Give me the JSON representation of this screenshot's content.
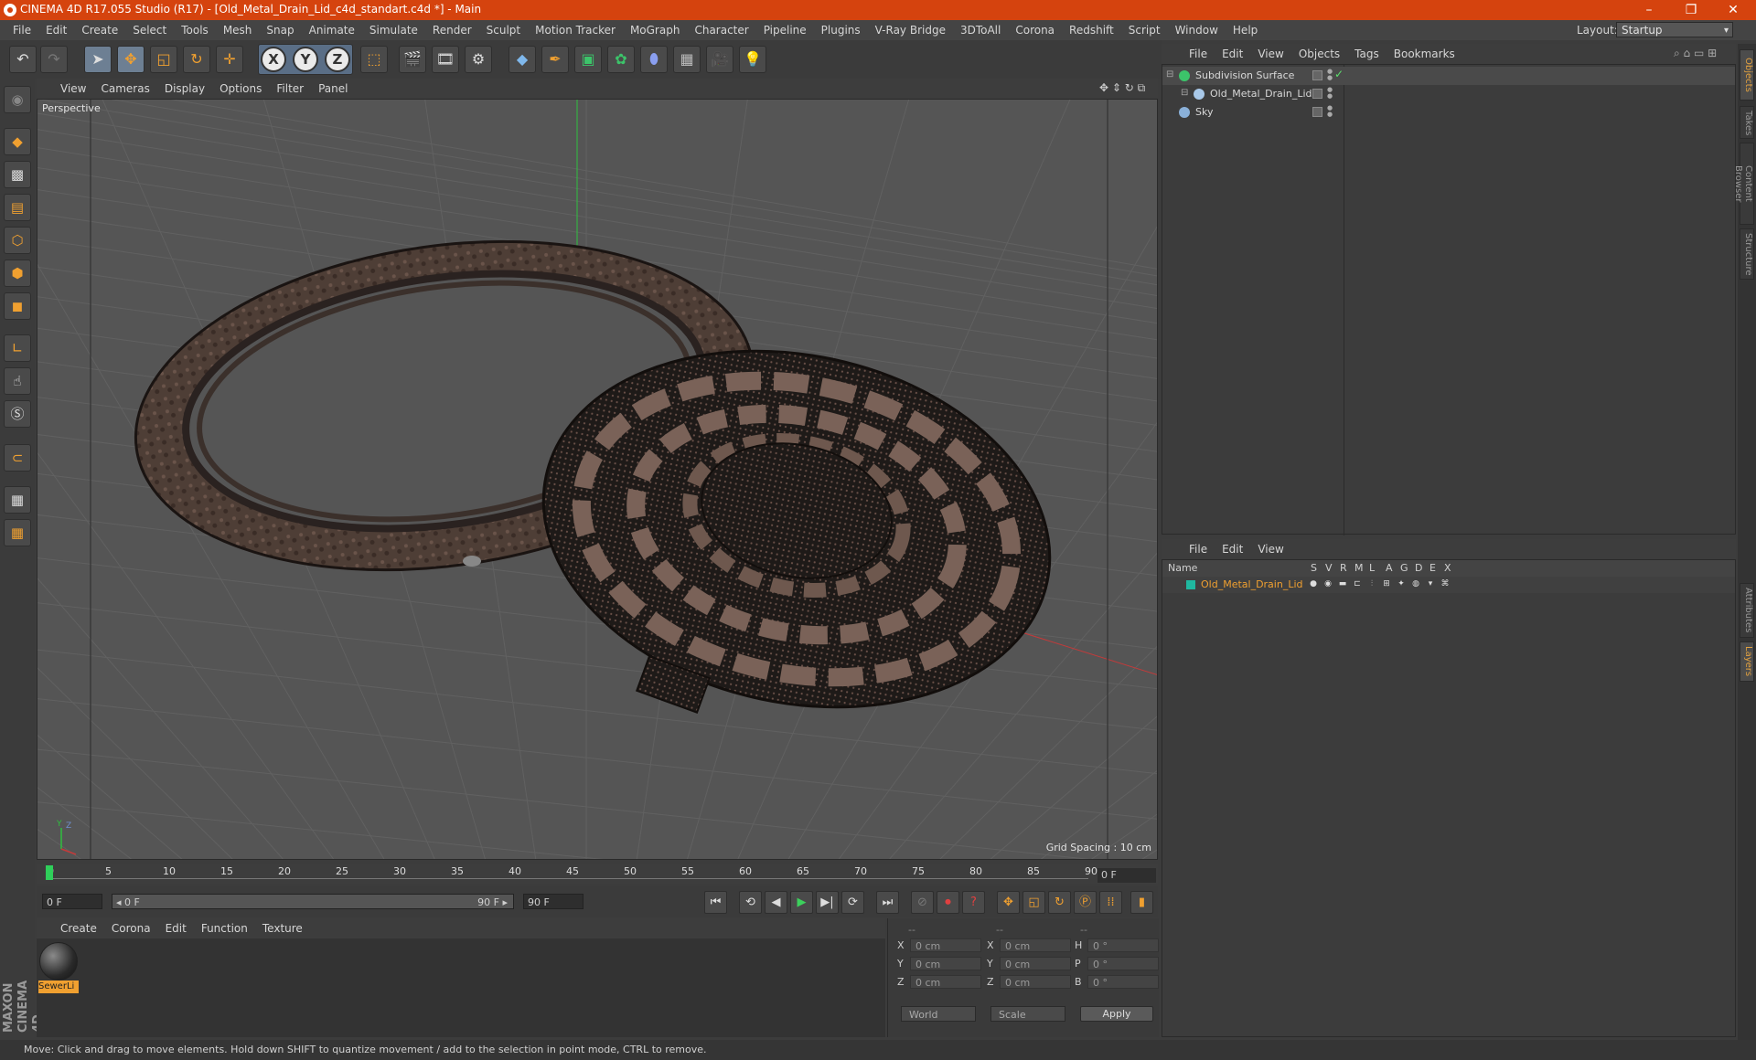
{
  "window": {
    "title": "CINEMA 4D R17.055 Studio (R17) - [Old_Metal_Drain_Lid_c4d_standart.c4d *] - Main",
    "controls": [
      "–",
      "❐",
      "✕"
    ]
  },
  "menubar": {
    "items": [
      "File",
      "Edit",
      "Create",
      "Select",
      "Tools",
      "Mesh",
      "Snap",
      "Animate",
      "Simulate",
      "Render",
      "Sculpt",
      "Motion Tracker",
      "MoGraph",
      "Character",
      "Pipeline",
      "Plugins",
      "V-Ray Bridge",
      "3DToAll",
      "Corona",
      "Redshift",
      "Script",
      "Window",
      "Help"
    ],
    "layout_label": "Layout:",
    "layout_value": "Startup"
  },
  "toolbar": {
    "axis_x": "X",
    "axis_y": "Y",
    "axis_z": "Z"
  },
  "viewport": {
    "menu": [
      "View",
      "Cameras",
      "Display",
      "Options",
      "Filter",
      "Panel"
    ],
    "label": "Perspective",
    "grid_spacing": "Grid Spacing : 10 cm",
    "colors": {
      "background": "#555555",
      "grid": "#616161",
      "axis_x": "#c43a3a",
      "axis_y": "#2fbf3f"
    }
  },
  "timeline": {
    "ticks": [
      "0",
      "5",
      "10",
      "15",
      "20",
      "25",
      "30",
      "35",
      "40",
      "45",
      "50",
      "55",
      "60",
      "65",
      "70",
      "75",
      "80",
      "85",
      "90"
    ],
    "current_frame": "0 F"
  },
  "transport": {
    "start_field": "0 F",
    "range_start": "◂ 0 F",
    "range_end": "90 F ▸",
    "end_field": "90 F"
  },
  "material_manager": {
    "menu": [
      "Create",
      "Corona",
      "Edit",
      "Function",
      "Texture"
    ],
    "material_name": "SewerLi"
  },
  "coordinates": {
    "headers": [
      "--",
      "--",
      "--"
    ],
    "rows": [
      {
        "l1": "X",
        "v1": "0 cm",
        "l2": "X",
        "v2": "0 cm",
        "l3": "H",
        "v3": "0 °"
      },
      {
        "l1": "Y",
        "v1": "0 cm",
        "l2": "Y",
        "v2": "0 cm",
        "l3": "P",
        "v3": "0 °"
      },
      {
        "l1": "Z",
        "v1": "0 cm",
        "l2": "Z",
        "v2": "0 cm",
        "l3": "B",
        "v3": "0 °"
      }
    ],
    "world": "World",
    "scale": "Scale",
    "apply": "Apply"
  },
  "status": {
    "text": "Move: Click and drag to move elements. Hold down SHIFT to quantize movement / add to the selection in point mode, CTRL to remove."
  },
  "object_manager": {
    "menu": [
      "File",
      "Edit",
      "View",
      "Objects",
      "Tags",
      "Bookmarks"
    ],
    "objects": [
      {
        "name": "Subdivision Surface",
        "icon_color": "#3cc46a"
      },
      {
        "name": "Old_Metal_Drain_Lid",
        "icon_color": "#a8c8e8"
      },
      {
        "name": "Sky",
        "icon_color": "#8ab0d8"
      }
    ]
  },
  "layer_manager": {
    "menu": [
      "File",
      "Edit",
      "View"
    ],
    "columns": [
      "Name",
      "S",
      "V",
      "R",
      "M",
      "L",
      "A",
      "G",
      "D",
      "E",
      "X"
    ],
    "layer_name": "Old_Metal_Drain_Lid",
    "layer_color": "#1fb8a0"
  },
  "right_tabs": [
    "Objects",
    "Takes",
    "Content Browser",
    "Structure",
    "Attributes",
    "Layers"
  ]
}
